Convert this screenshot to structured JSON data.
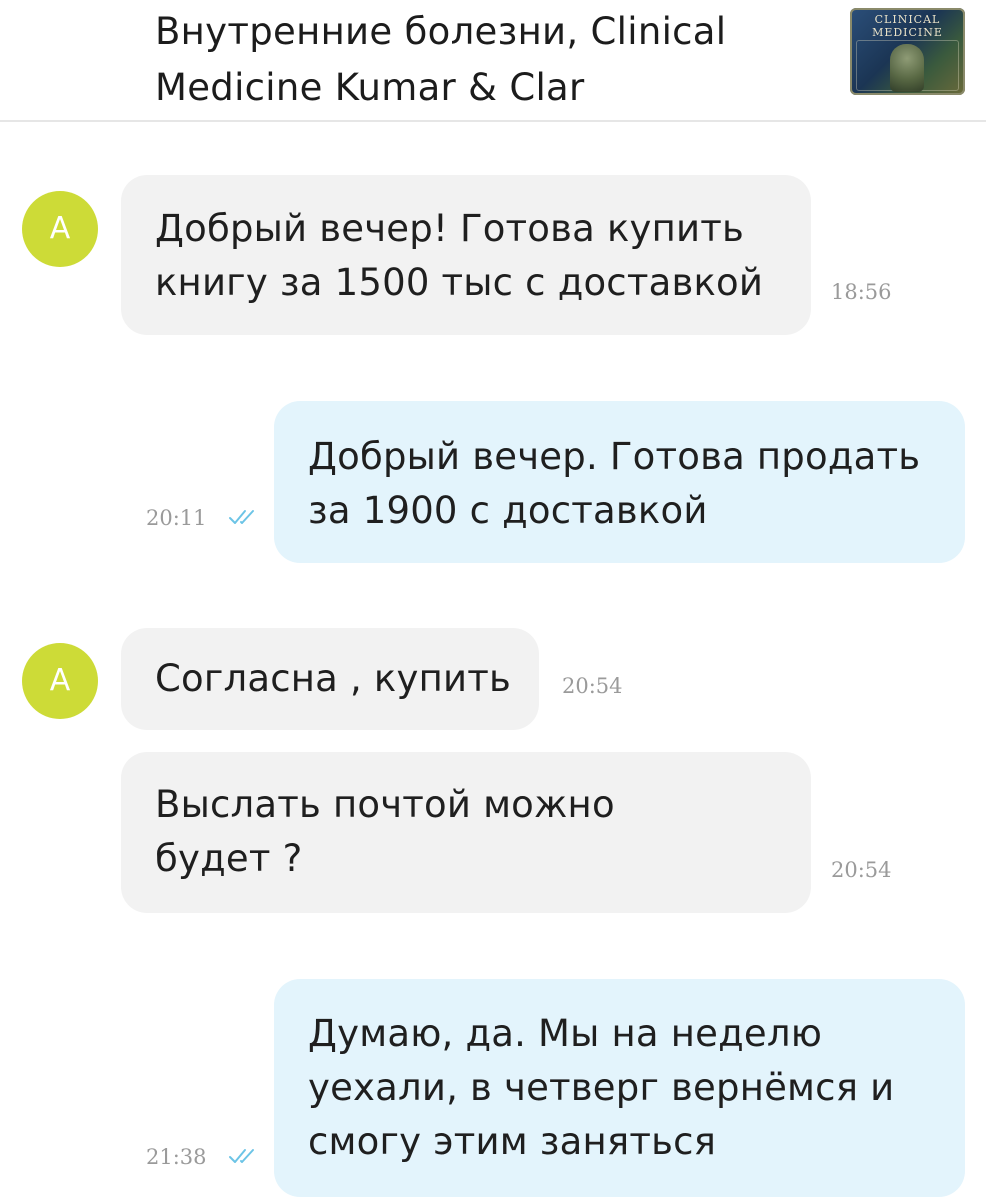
{
  "header": {
    "title_line1": "Внутренние болезни, Clinical",
    "title_line2": "Medicine Kumar & Clar",
    "thumbnail": {
      "line1": "CLINICAL",
      "line2": "MEDICINE"
    }
  },
  "messages": [
    {
      "direction": "incoming",
      "avatar_letter": "A",
      "lines": [
        "Добрый вечер! Готова купить",
        "книгу за 1500 тыс с доставкой"
      ],
      "time": "18:56"
    },
    {
      "direction": "outgoing",
      "lines": [
        "Добрый вечер. Готова продать",
        "за 1900 с доставкой"
      ],
      "time": "20:11",
      "read_icon": "double-check-icon"
    },
    {
      "direction": "incoming",
      "avatar_letter": "A",
      "lines": [
        "Согласна , купить"
      ],
      "time": "20:54"
    },
    {
      "direction": "incoming",
      "lines": [
        "Выслать почтой можно",
        "будет ?"
      ],
      "time": "20:54"
    },
    {
      "direction": "outgoing",
      "lines": [
        "Думаю, да. Мы на неделю",
        "уехали, в четверг вернёмся и",
        "смогу этим заняться"
      ],
      "time": "21:38",
      "read_icon": "double-check-icon"
    }
  ],
  "colors": {
    "avatar": "#cddb37",
    "incoming_bubble": "#f2f2f2",
    "outgoing_bubble": "#e3f4fc",
    "read_checks": "#6cc4e6",
    "timestamp": "#9a9a9a"
  }
}
